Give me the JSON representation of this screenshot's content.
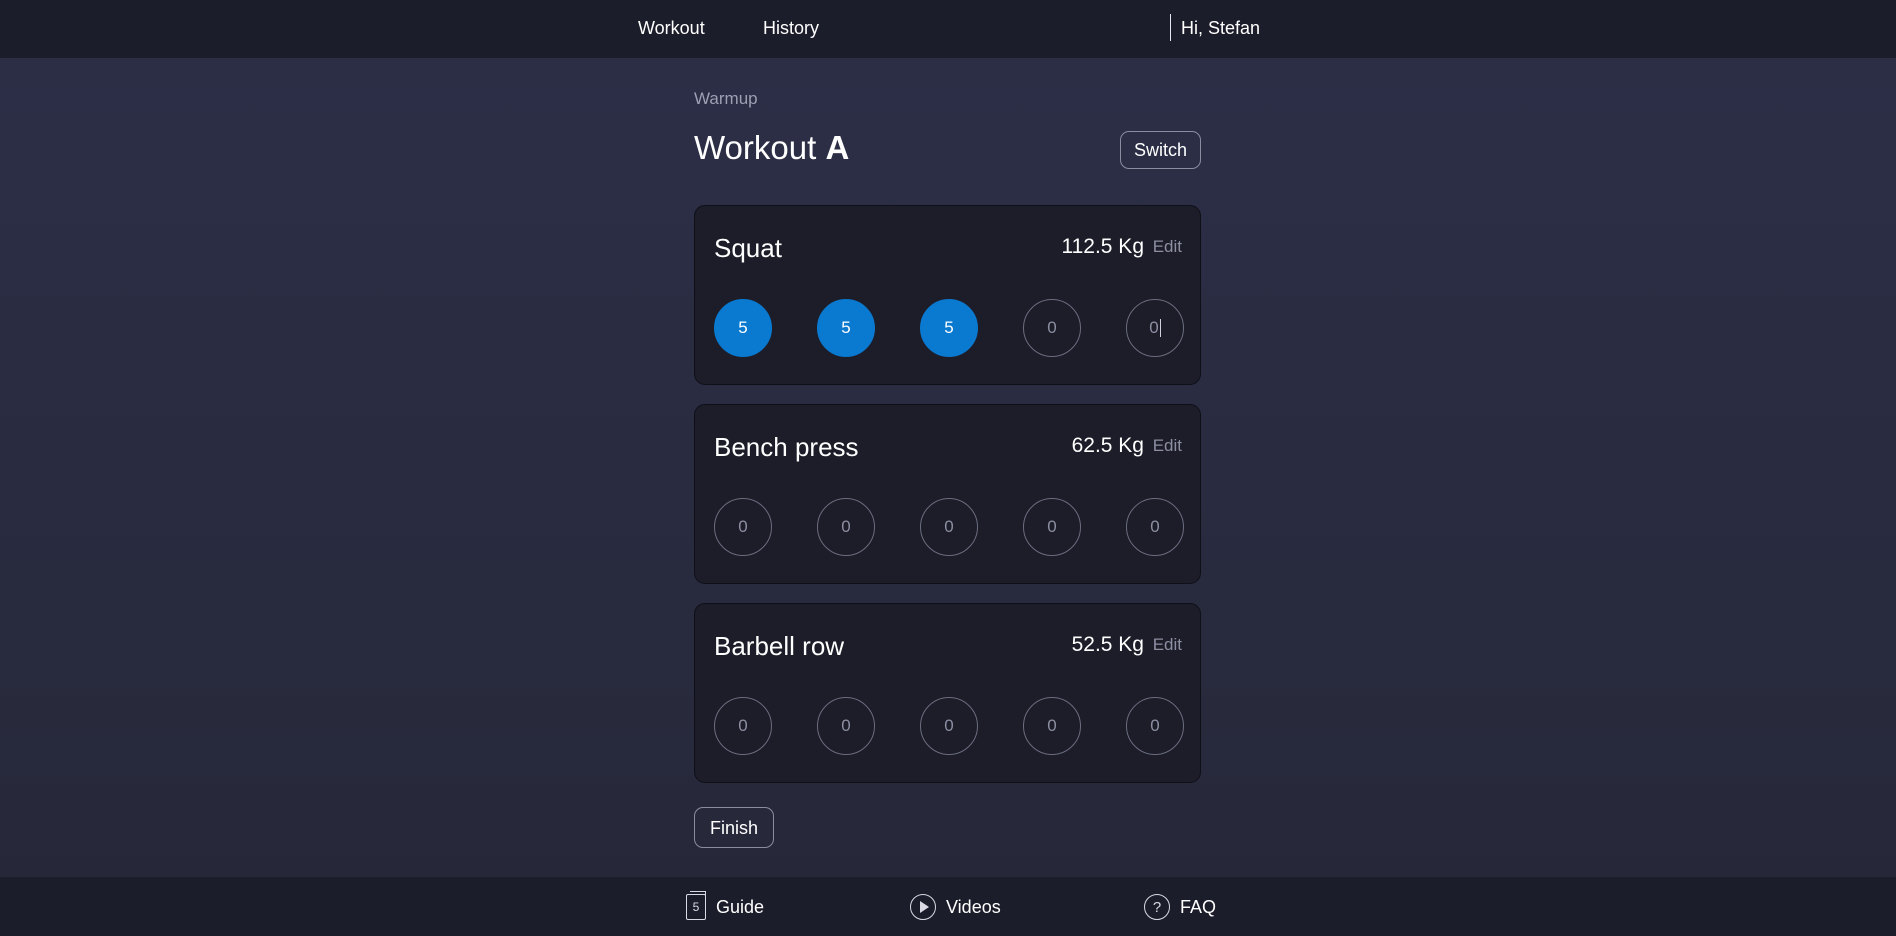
{
  "nav": {
    "workout": "Workout",
    "history": "History",
    "greeting": "Hi, Stefan"
  },
  "main": {
    "subtitle": "Warmup",
    "title_prefix": "Workout",
    "title_plan": "A",
    "switch_label": "Switch",
    "finish_label": "Finish"
  },
  "exercises": [
    {
      "name": "Squat",
      "weight": "112.5 Kg",
      "edit": "Edit",
      "sets": [
        "5",
        "5",
        "5",
        "0",
        "0"
      ],
      "completed": [
        true,
        true,
        true,
        false,
        false
      ]
    },
    {
      "name": "Bench press",
      "weight": "62.5 Kg",
      "edit": "Edit",
      "sets": [
        "0",
        "0",
        "0",
        "0",
        "0"
      ],
      "completed": [
        false,
        false,
        false,
        false,
        false
      ]
    },
    {
      "name": "Barbell row",
      "weight": "52.5 Kg",
      "edit": "Edit",
      "sets": [
        "0",
        "0",
        "0",
        "0",
        "0"
      ],
      "completed": [
        false,
        false,
        false,
        false,
        false
      ]
    }
  ],
  "footer": {
    "guide": {
      "label": "Guide",
      "icon": "book-icon",
      "icon_text": "5"
    },
    "videos": {
      "label": "Videos",
      "icon": "play-icon"
    },
    "faq": {
      "label": "FAQ",
      "icon": "help-icon",
      "icon_text": "?"
    }
  },
  "colors": {
    "background": "#2c2f47",
    "bar": "#1c1d2a",
    "card": "#1c1d29",
    "completed_set": "#0a79d0",
    "muted_text": "#8d8fa3"
  }
}
